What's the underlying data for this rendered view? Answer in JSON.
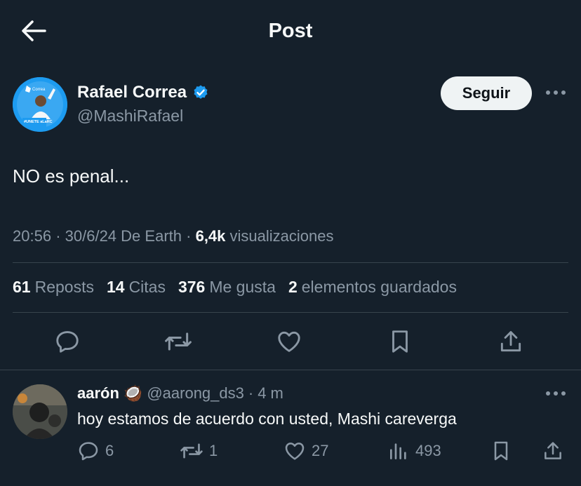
{
  "header": {
    "title": "Post"
  },
  "post": {
    "author_name": "Rafael Correa",
    "author_handle": "@MashiRafael",
    "avatar_text_top": "Correa",
    "avatar_text_bottom": "#UNETE aLaRC",
    "follow_label": "Seguir",
    "text": "NO es penal...",
    "time": "20:56",
    "date": "30/6/24",
    "source": "De Earth",
    "views_count": "6,4k",
    "views_label": "visualizaciones",
    "separator": "·"
  },
  "stats": {
    "reposts_count": "61",
    "reposts_label": "Reposts",
    "quotes_count": "14",
    "quotes_label": "Citas",
    "likes_count": "376",
    "likes_label": "Me gusta",
    "bookmarks_count": "2",
    "bookmarks_label": "elementos guardados"
  },
  "actions": [
    "reply-icon",
    "repost-icon",
    "like-icon",
    "bookmark-icon",
    "share-icon"
  ],
  "reply": {
    "author_name": "aarón",
    "author_emoji": "🥥",
    "author_handle": "@aarong_ds3",
    "separator": "·",
    "time": "4 m",
    "text": "hoy estamos de acuerdo con usted, Mashi careverga",
    "replies": "6",
    "reposts": "1",
    "likes": "27",
    "views": "493"
  },
  "colors": {
    "background": "#15202b",
    "text": "#f7f9f9",
    "muted": "#8b98a5",
    "divider": "#38444d",
    "verified": "#1d9bf0",
    "follow_bg": "#eff3f4"
  }
}
